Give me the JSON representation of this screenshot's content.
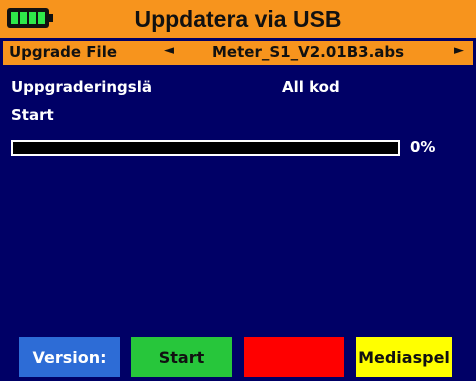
{
  "header": {
    "title": "Uppdatera via USB",
    "battery_icon": "battery-full-icon"
  },
  "file_row": {
    "label": "Upgrade File",
    "filename": "Meter_S1_V2.01B3.abs",
    "left_arrow": "◄",
    "right_arrow": "►"
  },
  "level": {
    "label": "Uppgraderingslä",
    "value": "All kod"
  },
  "status": {
    "label": "Start"
  },
  "progress": {
    "value": 0,
    "text": "0%"
  },
  "buttons": {
    "blue": "Version:",
    "green": "Start",
    "red": "",
    "yellow": "Mediaspel"
  },
  "colors": {
    "header": "#f7941d",
    "background": "#000066",
    "blue": "#2d6cd6",
    "green": "#27c63b",
    "red": "#ff0000",
    "yellow": "#ffff00"
  }
}
